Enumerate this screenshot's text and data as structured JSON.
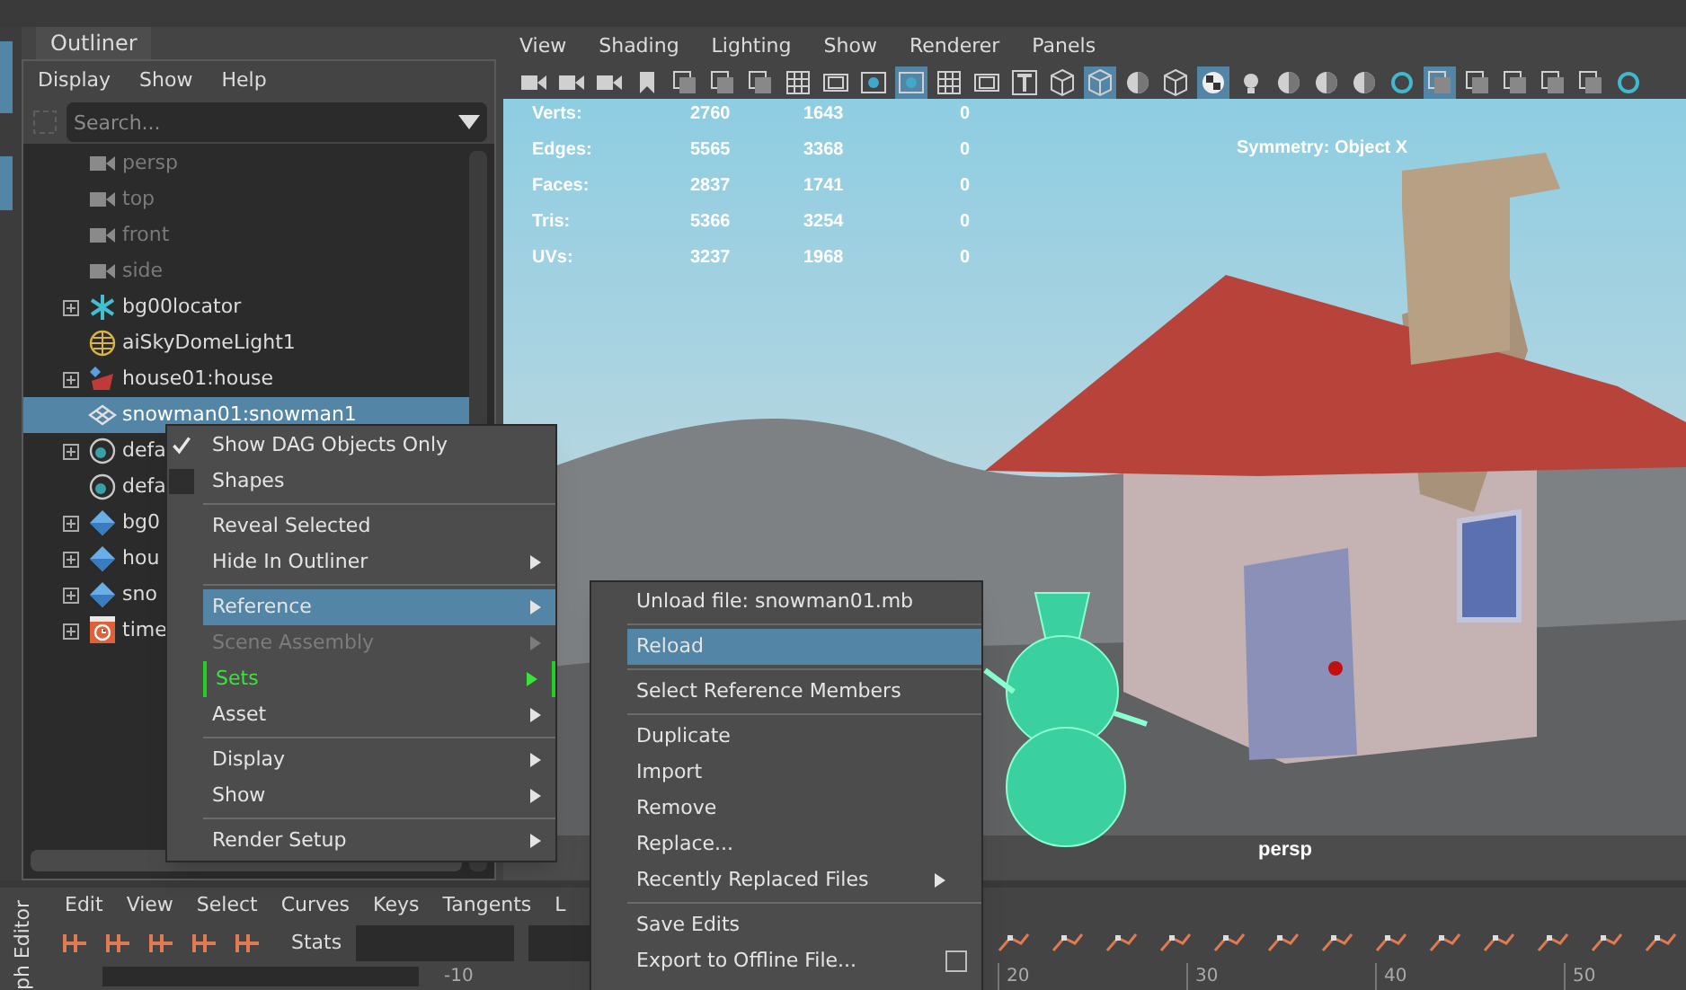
{
  "outliner": {
    "tab": "Outliner",
    "menu": [
      "Display",
      "Show",
      "Help"
    ],
    "search": {
      "placeholder": "Search..."
    },
    "items": [
      {
        "label": "persp",
        "kind": "camera",
        "dimmed": true,
        "expandable": false,
        "selected": false
      },
      {
        "label": "top",
        "kind": "camera",
        "dimmed": true,
        "expandable": false,
        "selected": false
      },
      {
        "label": "front",
        "kind": "camera",
        "dimmed": true,
        "expandable": false,
        "selected": false
      },
      {
        "label": "side",
        "kind": "camera",
        "dimmed": true,
        "expandable": false,
        "selected": false
      },
      {
        "label": "bg00locator",
        "kind": "locator",
        "dimmed": false,
        "expandable": true,
        "selected": false
      },
      {
        "label": "aiSkyDomeLight1",
        "kind": "dome",
        "dimmed": false,
        "expandable": false,
        "selected": false
      },
      {
        "label": "house01:house",
        "kind": "reference",
        "dimmed": false,
        "expandable": true,
        "selected": false
      },
      {
        "label": "snowman01:snowman1",
        "kind": "mesh",
        "dimmed": false,
        "expandable": false,
        "selected": true
      },
      {
        "label": "defa",
        "kind": "set",
        "dimmed": false,
        "expandable": true,
        "selected": false
      },
      {
        "label": "defa",
        "kind": "set",
        "dimmed": false,
        "expandable": false,
        "selected": false
      },
      {
        "label": "bg0",
        "kind": "diamond",
        "dimmed": false,
        "expandable": true,
        "selected": false
      },
      {
        "label": "hou",
        "kind": "diamond",
        "dimmed": false,
        "expandable": true,
        "selected": false
      },
      {
        "label": "sno",
        "kind": "diamond",
        "dimmed": false,
        "expandable": true,
        "selected": false
      },
      {
        "label": "time",
        "kind": "time",
        "dimmed": false,
        "expandable": true,
        "selected": false
      }
    ]
  },
  "context_menu": {
    "items": [
      {
        "kind": "check",
        "label": "Show DAG Objects Only",
        "checked": true,
        "submenu": false,
        "selected": false,
        "disabled": false
      },
      {
        "kind": "check",
        "label": "Shapes",
        "checked": false,
        "submenu": false,
        "selected": false,
        "disabled": false
      },
      {
        "kind": "separator"
      },
      {
        "kind": "item",
        "label": "Reveal Selected",
        "submenu": false,
        "selected": false,
        "disabled": false
      },
      {
        "kind": "item",
        "label": "Hide In Outliner",
        "submenu": true,
        "selected": false,
        "disabled": false
      },
      {
        "kind": "separator"
      },
      {
        "kind": "item",
        "label": "Reference",
        "submenu": true,
        "selected": true,
        "disabled": false
      },
      {
        "kind": "item",
        "label": "Scene Assembly",
        "submenu": true,
        "selected": false,
        "disabled": true
      },
      {
        "kind": "pinned",
        "label": "Sets",
        "submenu": true,
        "selected": false,
        "disabled": false
      },
      {
        "kind": "item",
        "label": "Asset",
        "submenu": true,
        "selected": false,
        "disabled": false
      },
      {
        "kind": "separator"
      },
      {
        "kind": "item",
        "label": "Display",
        "submenu": true,
        "selected": false,
        "disabled": false
      },
      {
        "kind": "item",
        "label": "Show",
        "submenu": true,
        "selected": false,
        "disabled": false
      },
      {
        "kind": "separator"
      },
      {
        "kind": "item",
        "label": "Render Setup",
        "submenu": true,
        "selected": false,
        "disabled": false
      }
    ]
  },
  "reference_submenu": {
    "items": [
      {
        "kind": "item",
        "label": "Unload file: snowman01.mb",
        "submenu": false,
        "selected": false,
        "option_box": false
      },
      {
        "kind": "separator"
      },
      {
        "kind": "item",
        "label": "Reload",
        "submenu": false,
        "selected": true,
        "option_box": false
      },
      {
        "kind": "separator"
      },
      {
        "kind": "item",
        "label": "Select Reference Members",
        "submenu": false,
        "selected": false,
        "option_box": false
      },
      {
        "kind": "separator"
      },
      {
        "kind": "item",
        "label": "Duplicate",
        "submenu": false,
        "selected": false,
        "option_box": false
      },
      {
        "kind": "item",
        "label": "Import",
        "submenu": false,
        "selected": false,
        "option_box": false
      },
      {
        "kind": "item",
        "label": "Remove",
        "submenu": false,
        "selected": false,
        "option_box": false
      },
      {
        "kind": "item",
        "label": "Replace...",
        "submenu": false,
        "selected": false,
        "option_box": false
      },
      {
        "kind": "item",
        "label": "Recently Replaced Files",
        "submenu": true,
        "selected": false,
        "option_box": false
      },
      {
        "kind": "separator"
      },
      {
        "kind": "item",
        "label": "Save Edits",
        "submenu": false,
        "selected": false,
        "option_box": false
      },
      {
        "kind": "item",
        "label": "Export to Offline File...",
        "submenu": false,
        "selected": false,
        "option_box": true
      }
    ]
  },
  "viewport": {
    "menu": [
      "View",
      "Shading",
      "Lighting",
      "Show",
      "Renderer",
      "Panels"
    ],
    "toolbar": [
      {
        "kind": "camera",
        "on": false
      },
      {
        "kind": "camera",
        "on": false
      },
      {
        "kind": "camera",
        "on": false
      },
      {
        "kind": "bookmark",
        "on": false
      },
      {
        "kind": "generic",
        "on": false
      },
      {
        "kind": "generic",
        "on": false
      },
      {
        "kind": "generic",
        "on": false
      },
      {
        "kind": "grid",
        "on": false
      },
      {
        "kind": "film",
        "on": false
      },
      {
        "kind": "dot",
        "on": false
      },
      {
        "kind": "dot",
        "on": true
      },
      {
        "kind": "grid",
        "on": false
      },
      {
        "kind": "film",
        "on": false
      },
      {
        "kind": "text",
        "on": false
      },
      {
        "kind": "cube",
        "on": false
      },
      {
        "kind": "cube",
        "on": true
      },
      {
        "kind": "sphere",
        "on": false
      },
      {
        "kind": "cube",
        "on": false
      },
      {
        "kind": "checker",
        "on": true
      },
      {
        "kind": "light",
        "on": false
      },
      {
        "kind": "sphere",
        "on": false
      },
      {
        "kind": "sphere",
        "on": false
      },
      {
        "kind": "sphere",
        "on": false
      },
      {
        "kind": "ring",
        "on": false
      },
      {
        "kind": "generic",
        "on": true
      },
      {
        "kind": "generic",
        "on": false
      },
      {
        "kind": "generic",
        "on": false
      },
      {
        "kind": "generic",
        "on": false
      },
      {
        "kind": "generic",
        "on": false
      },
      {
        "kind": "ring",
        "on": false
      }
    ],
    "stats": [
      {
        "label": "Verts:",
        "values": [
          "2760",
          "1643",
          "0"
        ]
      },
      {
        "label": "Edges:",
        "values": [
          "5565",
          "3368",
          "0"
        ]
      },
      {
        "label": "Faces:",
        "values": [
          "2837",
          "1741",
          "0"
        ]
      },
      {
        "label": "Tris:",
        "values": [
          "5366",
          "3254",
          "0"
        ]
      },
      {
        "label": "UVs:",
        "values": [
          "3237",
          "1968",
          "0"
        ]
      }
    ],
    "symmetry": "Symmetry: Object X",
    "camera_label": "persp"
  },
  "graph_editor": {
    "title": "ph Editor",
    "menu": [
      "Edit",
      "View",
      "Select",
      "Curves",
      "Keys",
      "Tangents",
      "L"
    ],
    "stats_label": "Stats",
    "range_start": "-10",
    "ruler": [
      "20",
      "30",
      "40",
      "50"
    ]
  }
}
